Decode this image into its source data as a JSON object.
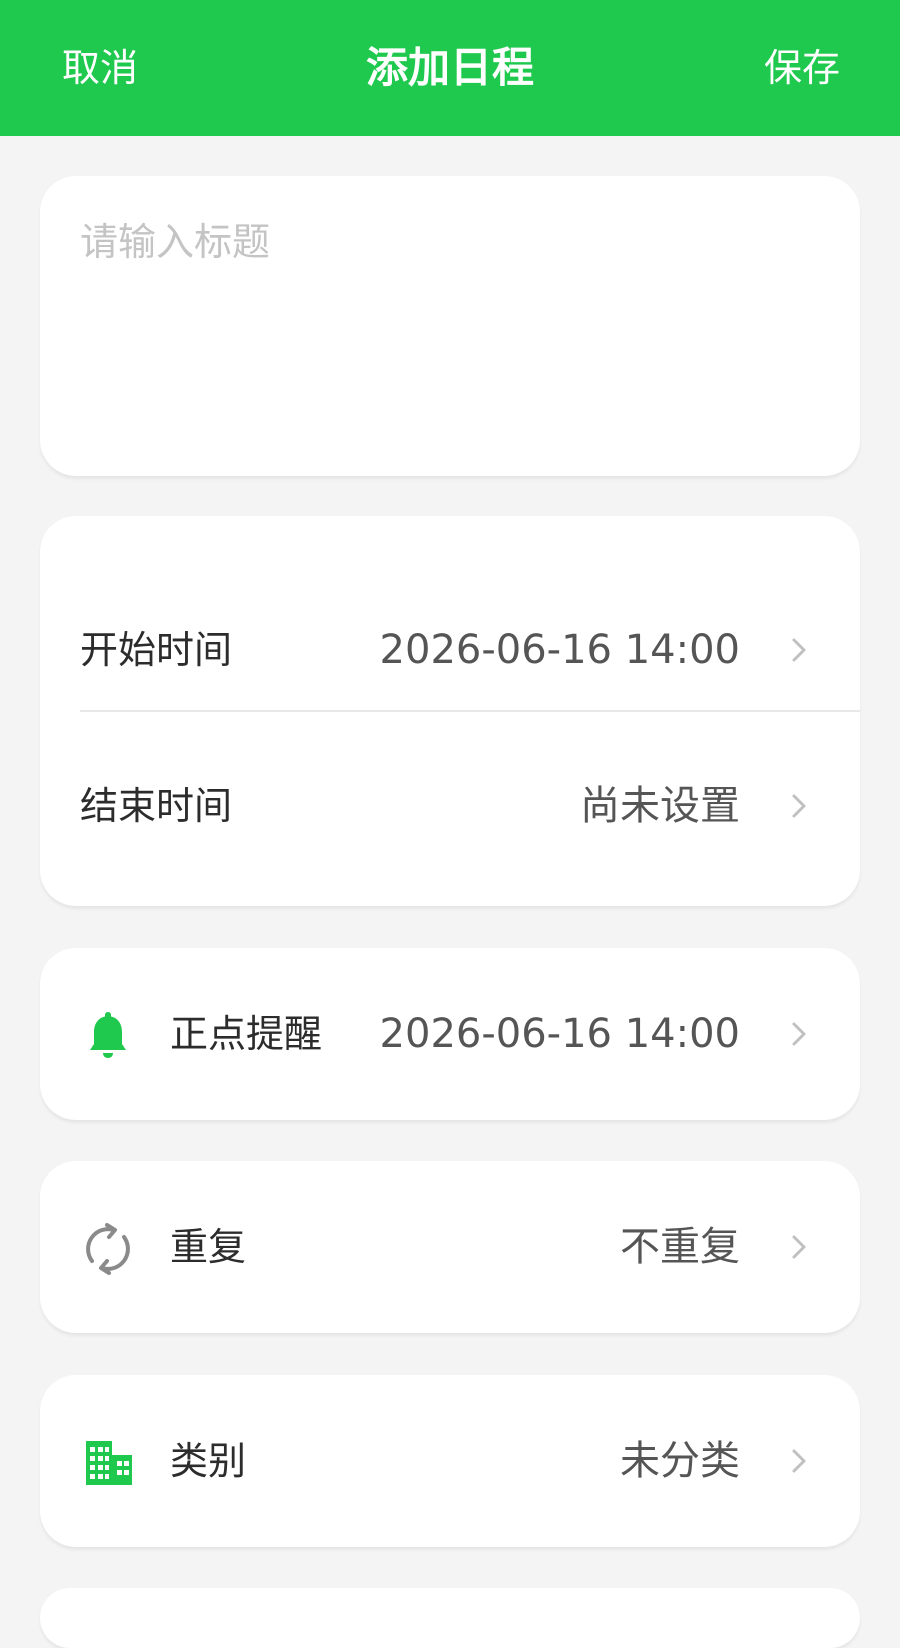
{
  "header": {
    "cancel_label": "取消",
    "title": "添加日程",
    "save_label": "保存",
    "background_color": "#1fc94e"
  },
  "title_input": {
    "placeholder": "请输入标题",
    "value": ""
  },
  "time": {
    "start_label": "开始时间",
    "start_value": "2026-06-16 14:00",
    "end_label": "结束时间",
    "end_value": "尚未设置"
  },
  "reminder": {
    "icon": "bell-icon",
    "label": "正点提醒",
    "value": "2026-06-16 14:00"
  },
  "repeat": {
    "icon": "repeat-icon",
    "label": "重复",
    "value": "不重复"
  },
  "category": {
    "icon": "building-icon",
    "label": "类别",
    "value": "未分类"
  },
  "colors": {
    "accent": "#1fc94e",
    "background": "#f4f4f4",
    "card": "#ffffff",
    "chevron": "#c0c0c0"
  }
}
